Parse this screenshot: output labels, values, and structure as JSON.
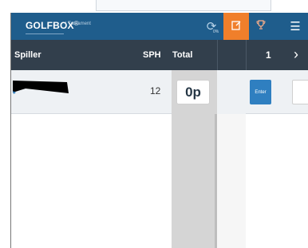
{
  "navbar": {
    "logo_text": "GOLFBOX",
    "logo_reg": "®",
    "logo_sub": "| Turnament",
    "refresh_sub": "0%",
    "bg_color": "#1f5d8c",
    "active_color": "#f07f2b",
    "icons": [
      "refresh-icon",
      "scorecard-icon",
      "trophy-icon",
      "menu-icon"
    ]
  },
  "header": {
    "player": "Spiller",
    "sph": "SPH",
    "total": "Total",
    "hole": "1",
    "next": "›"
  },
  "rows": [
    {
      "sph": "12",
      "total": "0p",
      "enter_label": "Enter"
    }
  ]
}
